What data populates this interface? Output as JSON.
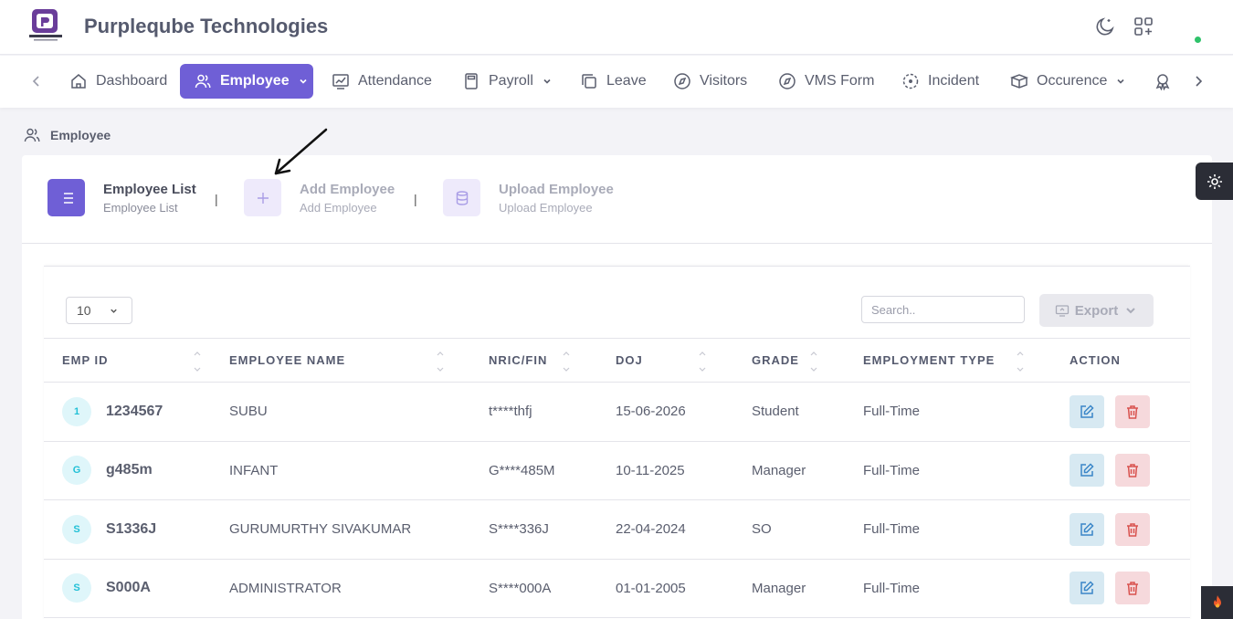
{
  "header": {
    "company_name": "Purpleqube Technologies",
    "logo_icon": "purpleqube-logo",
    "theme_icon": "moon-icon",
    "apps_icon": "apps-add-icon"
  },
  "nav": {
    "items": [
      {
        "label": "Dashboard",
        "icon": "home-icon"
      },
      {
        "label": "Employee",
        "icon": "users-icon",
        "active": true,
        "dropdown": true
      },
      {
        "label": "Attendance",
        "icon": "chart-icon"
      },
      {
        "label": "Payroll",
        "icon": "calculator-icon",
        "dropdown": true
      },
      {
        "label": "Leave",
        "icon": "copy-icon"
      },
      {
        "label": "Visitors",
        "icon": "compass-icon"
      },
      {
        "label": "VMS Form",
        "icon": "compass-icon"
      },
      {
        "label": "Incident",
        "icon": "focus-icon"
      },
      {
        "label": "Occurence",
        "icon": "box-icon",
        "dropdown": true
      }
    ]
  },
  "breadcrumb": {
    "label": "Employee"
  },
  "steps": [
    {
      "title": "Employee List",
      "subtitle": "Employee List",
      "icon": "list-icon",
      "active": true
    },
    {
      "title": "Add Employee",
      "subtitle": "Add Employee",
      "icon": "plus-icon"
    },
    {
      "title": "Upload Employee",
      "subtitle": "Upload Employee",
      "icon": "database-icon"
    }
  ],
  "step_separator": "|",
  "controls": {
    "page_size": "10",
    "search_placeholder": "Search..",
    "export_label": "Export"
  },
  "table": {
    "columns": [
      "EMP ID",
      "EMPLOYEE NAME",
      "NRIC/FIN",
      "DOJ",
      "GRADE",
      "EMPLOYMENT TYPE",
      "ACTION"
    ],
    "rows": [
      {
        "initial": "1",
        "emp_id": "1234567",
        "name": "SUBU",
        "nric": "t****thfj",
        "doj": "15-06-2026",
        "grade": "Student",
        "type": "Full-Time"
      },
      {
        "initial": "G",
        "emp_id": "g485m",
        "name": "INFANT",
        "nric": "G****485M",
        "doj": "10-11-2025",
        "grade": "Manager",
        "type": "Full-Time"
      },
      {
        "initial": "S",
        "emp_id": "S1336J",
        "name": "GURUMURTHY SIVAKUMAR",
        "nric": "S****336J",
        "doj": "22-04-2024",
        "grade": "SO",
        "type": "Full-Time"
      },
      {
        "initial": "S",
        "emp_id": "S000A",
        "name": "ADMINISTRATOR",
        "nric": "S****000A",
        "doj": "01-01-2005",
        "grade": "Manager",
        "type": "Full-Time"
      }
    ]
  },
  "colors": {
    "accent": "#6f5fd6",
    "avatar_bg": "#dff6fa",
    "avatar_text": "#21c0d6",
    "edit_bg": "#d7e9f2",
    "edit_icon": "#3a86c8",
    "delete_bg": "#f6d9dc",
    "delete_icon": "#d9534f",
    "online": "#2ec26a"
  }
}
